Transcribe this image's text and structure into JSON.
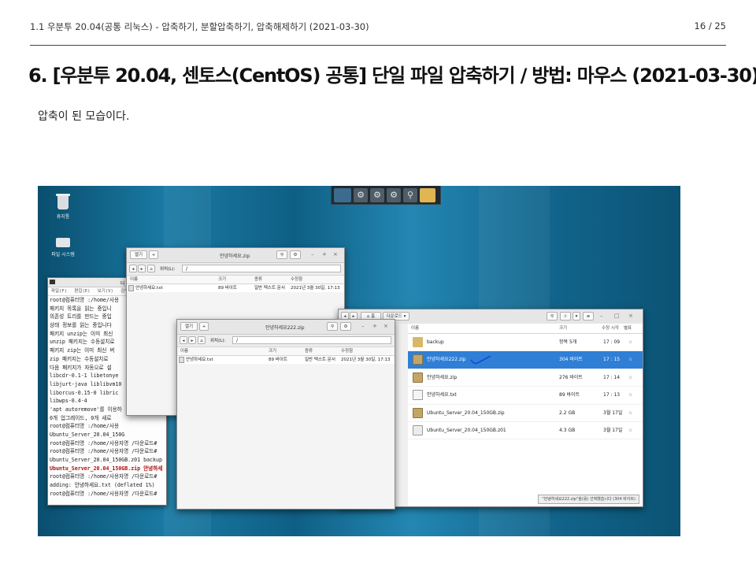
{
  "header": {
    "breadcrumb": "1.1 우분투 20.04(공통 리눅스) - 압축하기, 분할압축하기, 압축해제하기 (2021-03-30)",
    "page": "16 / 25"
  },
  "title": "6. [우분투 20.04, 센토스(CentOS) 공통] 단일 파일 압축하기 / 방법: 마우스 (2021-03-30)",
  "body_text": "압축이 된 모습이다.",
  "desktop": {
    "icons": [
      {
        "label": "휴지통"
      },
      {
        "label": "파일 시스템"
      }
    ]
  },
  "terminal": {
    "title": "터",
    "menu": [
      "파일(F)",
      "편집(E)",
      "보기(V)",
      "검색"
    ],
    "lines": [
      "root@컴퓨터명 :/home/사용",
      "패키지 목록을 읽는 중입니",
      "의존성 트리를 만드는 중입",
      "상태 정보를 읽는 중입니다",
      "패키지 unzip는 이미 최신",
      "unzip 패키지는 수동설치로",
      "패키지 zip는 이미 최신 버",
      "zip 패키지는 수동설치로",
      "다음 패키지가 자동으로 설",
      "  libcdr-0.1-1 libetonye",
      "  libjurt-java liblibvm10",
      "  liborcus-0.15-0 libric",
      "  libwps-0.4-4",
      "'apt autoremove'를 이용하",
      "0개 업그레이드, 0개 새로",
      "root@컴퓨터명 :/home/사용",
      "Ubuntu_Server_20.04_150G",
      "root@컴퓨터명 :/home/사용자명 /다운로드# ",
      "root@컴퓨터명 :/home/사용자명 /다운로드# ",
      "Ubuntu_Server_20.04_150GB.z01  backup",
      "Ubuntu_Server_20.04_150GB.zip  안녕하세",
      "root@컴퓨터명 :/home/사용자명 /다운로드# ",
      "  adding: 안녕하세요.txt (deflated 1%)",
      "root@컴퓨터명 :/home/사용자명 /다운로드# "
    ]
  },
  "fm_back": {
    "title": "안녕하세요.zip",
    "open_label": "열기",
    "location_label": "위치(L):",
    "path": "/",
    "columns": [
      "이름",
      "크기",
      "종류",
      "수정함"
    ],
    "rows": [
      {
        "name": "안녕하세요.txt",
        "size": "89 바이트",
        "type": "일반 텍스트 문서",
        "modified": "2021년 3월 30일, 17:13"
      }
    ]
  },
  "fm_front": {
    "title": "안녕하세요222.zip",
    "open_label": "열기",
    "location_label": "위치(L):",
    "path": "/",
    "columns": [
      "이름",
      "크기",
      "종류",
      "수정함"
    ],
    "rows": [
      {
        "name": "안녕하세요.txt",
        "size": "89 바이트",
        "type": "일반 텍스트 문서",
        "modified": "2021년 3월 30일, 17:13"
      }
    ]
  },
  "fm_nautilus": {
    "breadcrumb_home": "홈",
    "breadcrumb_folder": "다운로드",
    "columns": [
      "이름",
      "크기",
      "수정 시각",
      "별표"
    ],
    "rows": [
      {
        "name": "backup",
        "size": "항목 5개",
        "modified": "17 : 09",
        "kind": "folder",
        "selected": false
      },
      {
        "name": "안녕하세요222.zip",
        "size": "304 바이트",
        "modified": "17 : 15",
        "kind": "zip",
        "selected": true
      },
      {
        "name": "안녕하세요.zip",
        "size": "276 바이트",
        "modified": "17 : 14",
        "kind": "zip",
        "selected": false
      },
      {
        "name": "안녕하세요.txt",
        "size": "89 바이트",
        "modified": "17 : 13",
        "kind": "txt",
        "selected": false
      },
      {
        "name": "Ubuntu_Server_20.04_150GB.zip",
        "size": "2.2 GB",
        "modified": "3월 17일",
        "kind": "zip",
        "selected": false
      },
      {
        "name": "Ubuntu_Server_20.04_150GB.z01",
        "size": "4.3 GB",
        "modified": "3월 17일",
        "kind": "file",
        "selected": false
      }
    ],
    "status": "\"안녕하세요222.zip\"을(를) 선택했습니다 (304 바이트)"
  },
  "colors": {
    "selection": "#2f7fd6",
    "annotation": "#1a3fd0"
  }
}
